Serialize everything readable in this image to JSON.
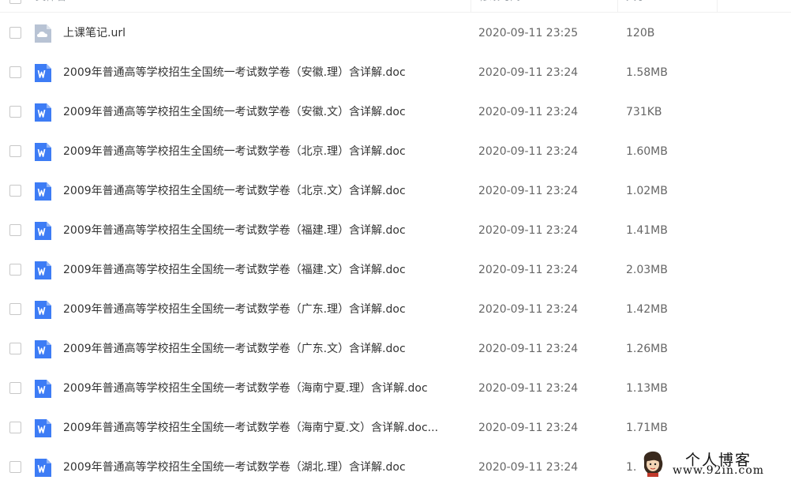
{
  "header": {
    "name_label": "文件名",
    "date_label": "修改时间",
    "size_label": "大小"
  },
  "files": [
    {
      "name": "上课笔记.url",
      "date": "2020-09-11 23:25",
      "size": "120B",
      "icon": "link-file-icon"
    },
    {
      "name": "2009年普通高等学校招生全国统一考试数学卷（安徽.理）含详解.doc",
      "date": "2020-09-11 23:24",
      "size": "1.58MB",
      "icon": "word-doc-icon"
    },
    {
      "name": "2009年普通高等学校招生全国统一考试数学卷（安徽.文）含详解.doc",
      "date": "2020-09-11 23:24",
      "size": "731KB",
      "icon": "word-doc-icon"
    },
    {
      "name": "2009年普通高等学校招生全国统一考试数学卷（北京.理）含详解.doc",
      "date": "2020-09-11 23:24",
      "size": "1.60MB",
      "icon": "word-doc-icon"
    },
    {
      "name": "2009年普通高等学校招生全国统一考试数学卷（北京.文）含详解.doc",
      "date": "2020-09-11 23:24",
      "size": "1.02MB",
      "icon": "word-doc-icon"
    },
    {
      "name": "2009年普通高等学校招生全国统一考试数学卷（福建.理）含详解.doc",
      "date": "2020-09-11 23:24",
      "size": "1.41MB",
      "icon": "word-doc-icon"
    },
    {
      "name": "2009年普通高等学校招生全国统一考试数学卷（福建.文）含详解.doc",
      "date": "2020-09-11 23:24",
      "size": "2.03MB",
      "icon": "word-doc-icon"
    },
    {
      "name": "2009年普通高等学校招生全国统一考试数学卷（广东.理）含详解.doc",
      "date": "2020-09-11 23:24",
      "size": "1.42MB",
      "icon": "word-doc-icon"
    },
    {
      "name": "2009年普通高等学校招生全国统一考试数学卷（广东.文）含详解.doc",
      "date": "2020-09-11 23:24",
      "size": "1.26MB",
      "icon": "word-doc-icon"
    },
    {
      "name": "2009年普通高等学校招生全国统一考试数学卷（海南宁夏.理）含详解.doc",
      "date": "2020-09-11 23:24",
      "size": "1.13MB",
      "icon": "word-doc-icon"
    },
    {
      "name": "2009年普通高等学校招生全国统一考试数学卷（海南宁夏.文）含详解.doc...",
      "date": "2020-09-11 23:24",
      "size": "1.71MB",
      "icon": "word-doc-icon"
    },
    {
      "name": "2009年普通高等学校招生全国统一考试数学卷（湖北.理）含详解.doc",
      "date": "2020-09-11 23:24",
      "size": "1.",
      "icon": "word-doc-icon"
    }
  ],
  "watermark": {
    "title": "个人博客",
    "url": "www.92in.com"
  },
  "colors": {
    "word_icon": "#3d7cf5",
    "link_icon": "#b8c3d4",
    "sort_indicator": "#3b8cff"
  }
}
